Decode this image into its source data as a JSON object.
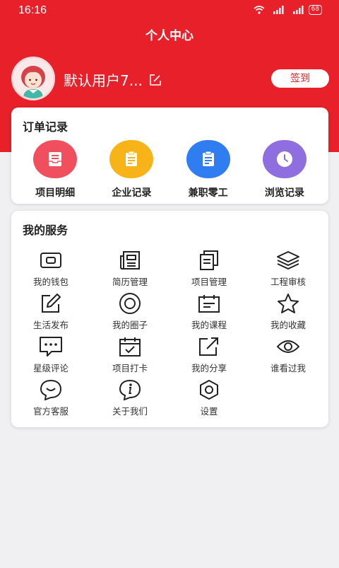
{
  "status": {
    "time": "16:16",
    "battery": "68"
  },
  "header": {
    "title": "个人中心"
  },
  "profile": {
    "username": "默认用户7...",
    "signin_label": "签到"
  },
  "orders": {
    "title": "订单记录",
    "items": [
      {
        "label": "项目明细",
        "icon": "inbox-icon",
        "color": "#f0505e"
      },
      {
        "label": "企业记录",
        "icon": "clipboard-icon",
        "color": "#f7b418"
      },
      {
        "label": "兼职零工",
        "icon": "clipboard-icon",
        "color": "#2f7df0"
      },
      {
        "label": "浏览记录",
        "icon": "clock-icon",
        "color": "#8f6ee0"
      }
    ]
  },
  "services": {
    "title": "我的服务",
    "items": [
      {
        "label": "我的钱包",
        "icon": "wallet-icon"
      },
      {
        "label": "简历管理",
        "icon": "newspaper-icon"
      },
      {
        "label": "项目管理",
        "icon": "copy-icon"
      },
      {
        "label": "工程审核",
        "icon": "layers-icon"
      },
      {
        "label": "生活发布",
        "icon": "edit-icon"
      },
      {
        "label": "我的圈子",
        "icon": "circle-icon"
      },
      {
        "label": "我的课程",
        "icon": "calendar-icon"
      },
      {
        "label": "我的收藏",
        "icon": "star-icon"
      },
      {
        "label": "星级评论",
        "icon": "comment-icon"
      },
      {
        "label": "项目打卡",
        "icon": "calendar-check-icon"
      },
      {
        "label": "我的分享",
        "icon": "share-icon"
      },
      {
        "label": "谁看过我",
        "icon": "eye-icon"
      },
      {
        "label": "官方客服",
        "icon": "chat-smile-icon"
      },
      {
        "label": "关于我们",
        "icon": "info-icon"
      },
      {
        "label": "设置",
        "icon": "settings-icon"
      }
    ]
  }
}
